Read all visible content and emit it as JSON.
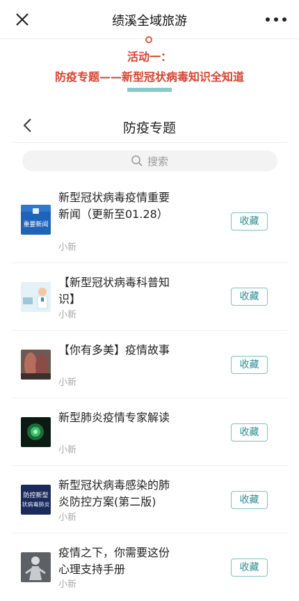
{
  "topbar": {
    "title": "绩溪全域旅游",
    "close_icon": "close-icon",
    "more_icon": "more-icon"
  },
  "banner": {
    "line1": "活动一：",
    "line2": "防疫专题——新型冠状病毒知识全知道"
  },
  "nav": {
    "title": "防疫专题",
    "back_icon": "chevron-left-icon"
  },
  "search": {
    "placeholder": "搜索",
    "icon": "search-icon"
  },
  "colors": {
    "accent_red": "#d9432f",
    "accent_teal": "#2d8d90",
    "banner_bar": "#8bc9c9"
  },
  "items": [
    {
      "title": "新型冠状病毒疫情重要新闻（更新至01.28）",
      "source": "小新",
      "button": "收藏",
      "thumb_text": "重要新闻"
    },
    {
      "title": "【新型冠状病毒科普知识】",
      "source": "小新",
      "button": "收藏"
    },
    {
      "title": "【你有多美】疫情故事",
      "source": "小新",
      "button": "收藏"
    },
    {
      "title": "新型肺炎疫情专家解读",
      "source": "小新",
      "button": "收藏"
    },
    {
      "title": "新型冠状病毒感染的肺炎防控方案(第二版)",
      "source": "小新",
      "button": "收藏",
      "thumb_text": "防控新型 状病毒肺炎"
    },
    {
      "title": "疫情之下，你需要这份心理支持手册",
      "source": "小新",
      "button": "收藏"
    }
  ]
}
